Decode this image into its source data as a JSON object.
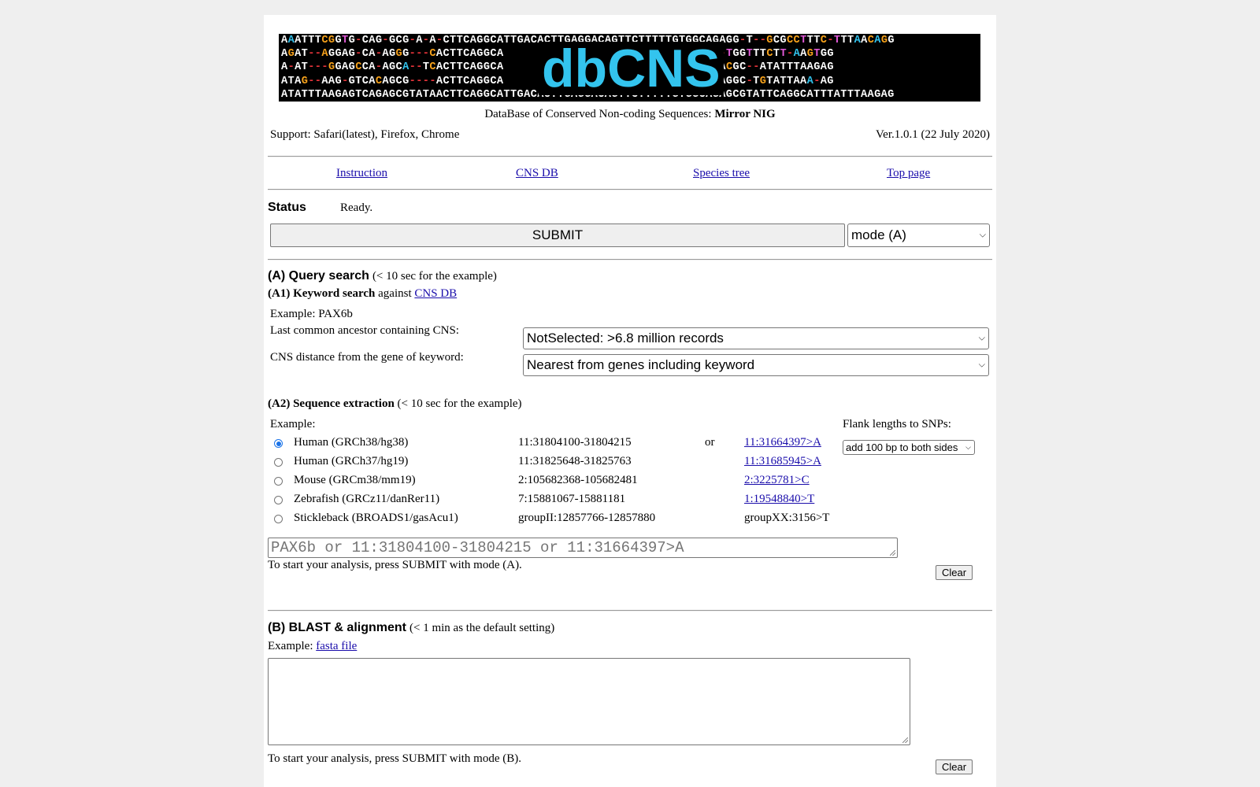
{
  "banner": {
    "logo": "dbCNS",
    "lines": [
      [
        [
          "w",
          "A"
        ],
        [
          "c",
          "A"
        ],
        [
          "w",
          "ATTT"
        ],
        [
          "g",
          "C"
        ],
        [
          "g",
          "G"
        ],
        [
          "w",
          "G"
        ],
        [
          "m",
          "T"
        ],
        [
          "w",
          "G"
        ],
        [
          "r",
          "-"
        ],
        [
          "w",
          "CAG"
        ],
        [
          "r",
          "-"
        ],
        [
          "w",
          "GCG"
        ],
        [
          "r",
          "-"
        ],
        [
          "w",
          "A"
        ],
        [
          "r",
          "-"
        ],
        [
          "w",
          "A"
        ],
        [
          "r",
          "-"
        ],
        [
          "w",
          "CTTCAGGCATTGACACTTGAGGACAGTTCTTTTTGTGGCAGAGG"
        ],
        [
          "r",
          "-"
        ],
        [
          "w",
          "T"
        ],
        [
          "r",
          "--"
        ],
        [
          "g",
          "G"
        ],
        [
          "w",
          "CG"
        ],
        [
          "g",
          "CC"
        ],
        [
          "m",
          "T"
        ],
        [
          "w",
          "TT"
        ],
        [
          "g",
          "C"
        ],
        [
          "r",
          "-"
        ],
        [
          "m",
          "T"
        ],
        [
          "w",
          "TT"
        ],
        [
          "c",
          "A"
        ],
        [
          "w",
          "A"
        ],
        [
          "g",
          "C"
        ],
        [
          "c",
          "A"
        ],
        [
          "g",
          "G"
        ],
        [
          "w",
          "G"
        ]
      ],
      [
        [
          "w",
          "A"
        ],
        [
          "g",
          "G"
        ],
        [
          "w",
          "AT"
        ],
        [
          "r",
          "--"
        ],
        [
          "g",
          "A"
        ],
        [
          "w",
          "GGAG"
        ],
        [
          "r",
          "-"
        ],
        [
          "w",
          "CA"
        ],
        [
          "r",
          "-"
        ],
        [
          "w",
          "AG"
        ],
        [
          "g",
          "G"
        ],
        [
          "w",
          "G"
        ],
        [
          "r",
          "---"
        ],
        [
          "g",
          "C"
        ],
        [
          "w",
          "ACTTCAGGCA                GTGGCAGAGG"
        ],
        [
          "r",
          "-"
        ],
        [
          "w",
          "T"
        ],
        [
          "r",
          "--"
        ],
        [
          "c",
          "A"
        ],
        [
          "w",
          "C"
        ],
        [
          "r",
          "-"
        ],
        [
          "m",
          "T"
        ],
        [
          "w",
          "GG"
        ],
        [
          "m",
          "T"
        ],
        [
          "w",
          "TT"
        ],
        [
          "g",
          "C"
        ],
        [
          "w",
          "T"
        ],
        [
          "m",
          "T"
        ],
        [
          "r",
          "-"
        ],
        [
          "c",
          "A"
        ],
        [
          "w",
          "A"
        ],
        [
          "g",
          "G"
        ],
        [
          "m",
          "T"
        ],
        [
          "w",
          "GG"
        ]
      ],
      [
        [
          "w",
          "A"
        ],
        [
          "r",
          "-"
        ],
        [
          "w",
          "AT"
        ],
        [
          "r",
          "---"
        ],
        [
          "g",
          "G"
        ],
        [
          "w",
          "GAG"
        ],
        [
          "g",
          "C"
        ],
        [
          "w",
          "CA"
        ],
        [
          "r",
          "-"
        ],
        [
          "w",
          "AGC"
        ],
        [
          "c",
          "A"
        ],
        [
          "r",
          "--"
        ],
        [
          "w",
          "T"
        ],
        [
          "g",
          "C"
        ],
        [
          "w",
          "ACTTCAGGCA                GTGGCAGAGGGT"
        ],
        [
          "r",
          "---"
        ],
        [
          "w",
          "CA"
        ],
        [
          "g",
          "C"
        ],
        [
          "w",
          "GC"
        ],
        [
          "r",
          "--"
        ],
        [
          "w",
          "ATATTTAAGAG"
        ]
      ],
      [
        [
          "w",
          "ATA"
        ],
        [
          "g",
          "G"
        ],
        [
          "r",
          "--"
        ],
        [
          "w",
          "AAG"
        ],
        [
          "r",
          "-"
        ],
        [
          "w",
          "GTCA"
        ],
        [
          "g",
          "C"
        ],
        [
          "w",
          "AGCG"
        ],
        [
          "r",
          "----"
        ],
        [
          "w",
          "ACTTCAGGCA                GTGGCAGAGGGT"
        ],
        [
          "r",
          "---"
        ],
        [
          "w",
          "CAGGC"
        ],
        [
          "r",
          "-"
        ],
        [
          "w",
          "T"
        ],
        [
          "g",
          "G"
        ],
        [
          "w",
          "TATTAA"
        ],
        [
          "c",
          "A"
        ],
        [
          "r",
          "-"
        ],
        [
          "w",
          "AG"
        ]
      ],
      [
        [
          "w",
          "ATATTTAAGAGTCAGAGCGTATAACTTCAGGCATTGACACTTGAGGACAGTTCTTTTTGTGGCAGAGCGTATTCAGGCATTTATTTAAGAG"
        ]
      ]
    ]
  },
  "header": {
    "subtitle_prefix": "DataBase of Conserved Non-coding Sequences:",
    "subtitle_bold": "Mirror NIG",
    "support": "Support: Safari(latest), Firefox, Chrome",
    "version": "Ver.1.0.1 (22 July 2020)"
  },
  "nav": {
    "instruction": "Instruction",
    "cns_db": "CNS DB",
    "species_tree": "Species tree",
    "top_page": "Top page"
  },
  "status": {
    "label": "Status",
    "value": "Ready."
  },
  "submit": {
    "label": "SUBMIT",
    "mode_selected": "mode (A)"
  },
  "section_a": {
    "title": "(A) Query search",
    "note": "(< 10 sec for the example)",
    "a1_title": "(A1) Keyword search",
    "a1_against": "against",
    "a1_link": "CNS DB",
    "a1_example": "Example: PAX6b",
    "lca_label": "Last common ancestor containing CNS:",
    "lca_selected": "NotSelected: >6.8 million records",
    "distance_label": "CNS distance from the gene of keyword:",
    "distance_selected": "Nearest from genes including keyword",
    "a2_title": "(A2) Sequence extraction",
    "a2_note": "(< 10 sec for the example)",
    "a2_example": "Example:",
    "or": "or",
    "flank_label": "Flank lengths to SNPs:",
    "flank_selected": "add 100 bp to both sides",
    "species": [
      {
        "name": "Human (GRCh38/hg38)",
        "region": "11:31804100-31804215",
        "snp": "11:31664397>A",
        "snp_link": true,
        "selected": true
      },
      {
        "name": "Human (GRCh37/hg19)",
        "region": "11:31825648-31825763",
        "snp": "11:31685945>A",
        "snp_link": true,
        "selected": false
      },
      {
        "name": "Mouse (GRCm38/mm19)",
        "region": "2:105682368-105682481",
        "snp": "2:3225781>C",
        "snp_link": true,
        "selected": false
      },
      {
        "name": "Zebrafish (GRCz11/danRer11)",
        "region": "7:15881067-15881181",
        "snp": "1:19548840>T",
        "snp_link": true,
        "selected": false
      },
      {
        "name": "Stickleback (BROADS1/gasAcu1)",
        "region": "groupII:12857766-12857880",
        "snp": "groupXX:3156>T",
        "snp_link": false,
        "selected": false
      }
    ],
    "query_placeholder": "PAX6b or 11:31804100-31804215 or 11:31664397>A",
    "hint": "To start your analysis, press SUBMIT with mode (A).",
    "clear": "Clear"
  },
  "section_b": {
    "title": "(B) BLAST & alignment",
    "note": "(< 1 min as the default setting)",
    "example_label": "Example:",
    "example_link": "fasta file",
    "hint": "To start your analysis, press SUBMIT with mode (B).",
    "clear": "Clear"
  }
}
